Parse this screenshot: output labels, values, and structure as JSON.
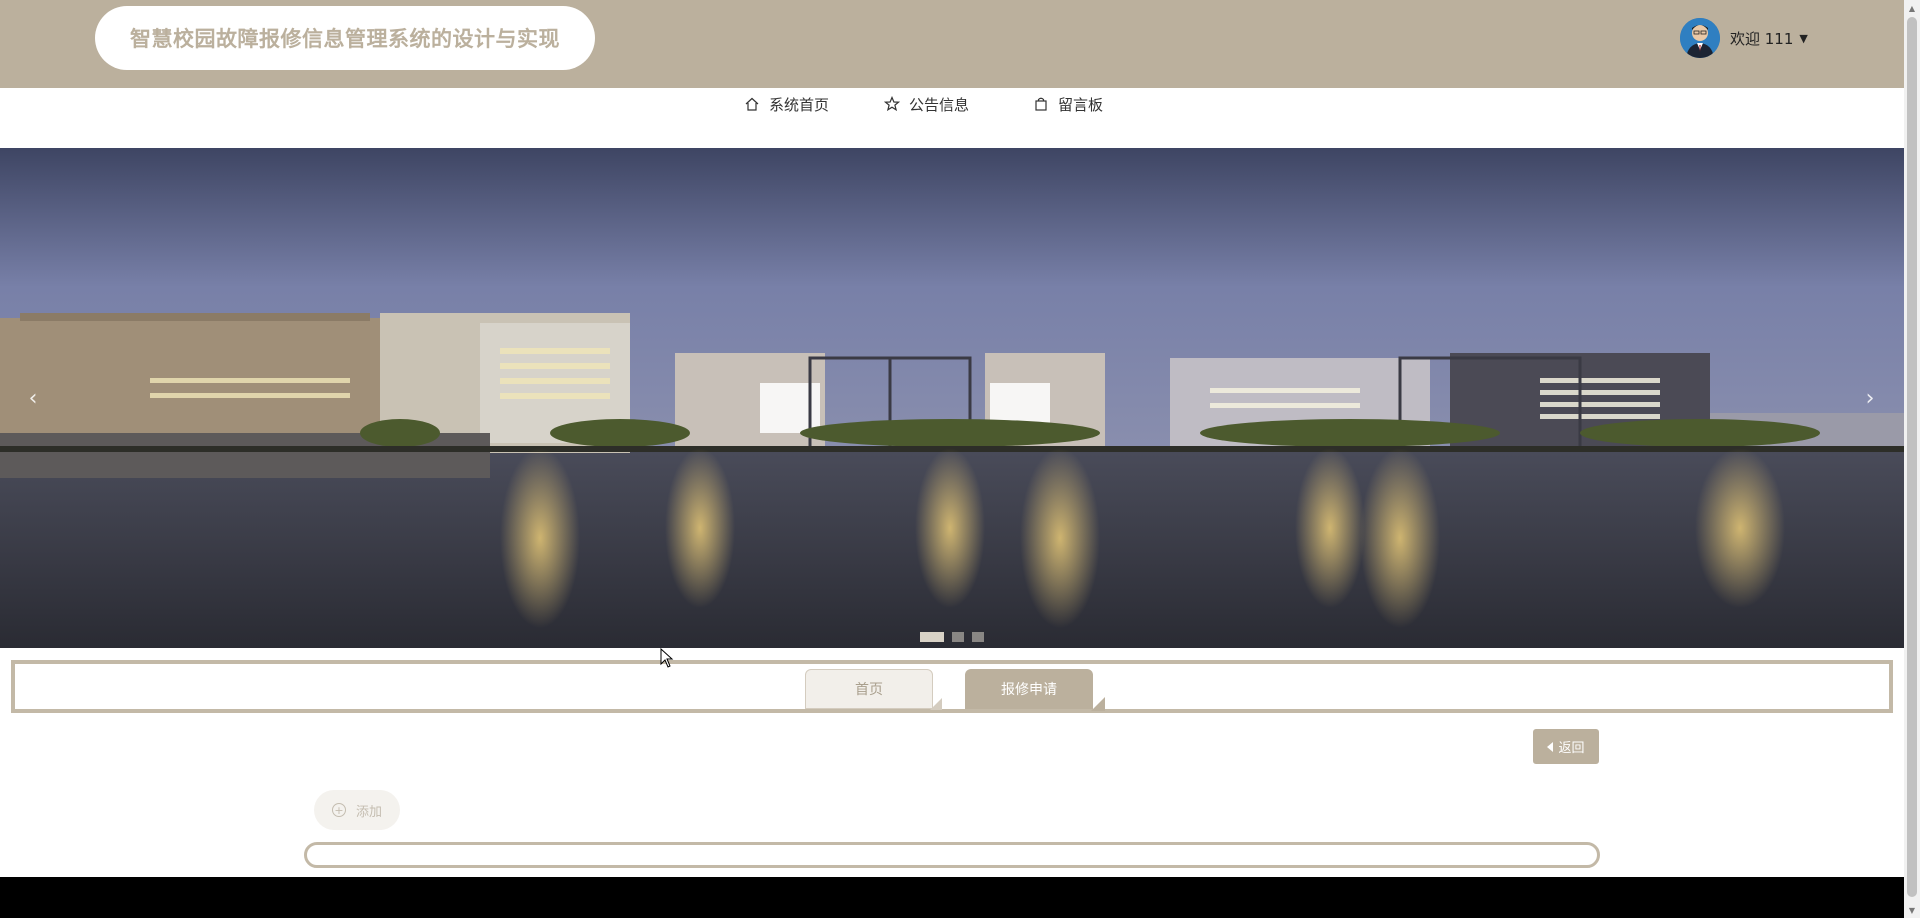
{
  "header": {
    "title": "智慧校园故障报修信息管理系统的设计与实现",
    "welcome": "欢迎 111",
    "avatar_icon": "user-avatar",
    "caret_icon": "caret-down-icon",
    "bg_color": "#bbb09d"
  },
  "nav": {
    "items": [
      {
        "label": "系统首页",
        "icon": "home-icon"
      },
      {
        "label": "公告信息",
        "icon": "star-icon"
      },
      {
        "label": "留言板",
        "icon": "bag-icon"
      }
    ]
  },
  "carousel": {
    "slide_count": 3,
    "active_index": 0,
    "prev_label": "‹",
    "next_label": "›"
  },
  "breadcrumb": {
    "home": "首页",
    "current": "报修申请"
  },
  "actions": {
    "back_label": "返回",
    "add_label": "添加",
    "add_icon": "plus-circle-icon"
  },
  "colors": {
    "accent": "#bbb09d",
    "border": "#c3b9a7",
    "footer": "#000000"
  }
}
